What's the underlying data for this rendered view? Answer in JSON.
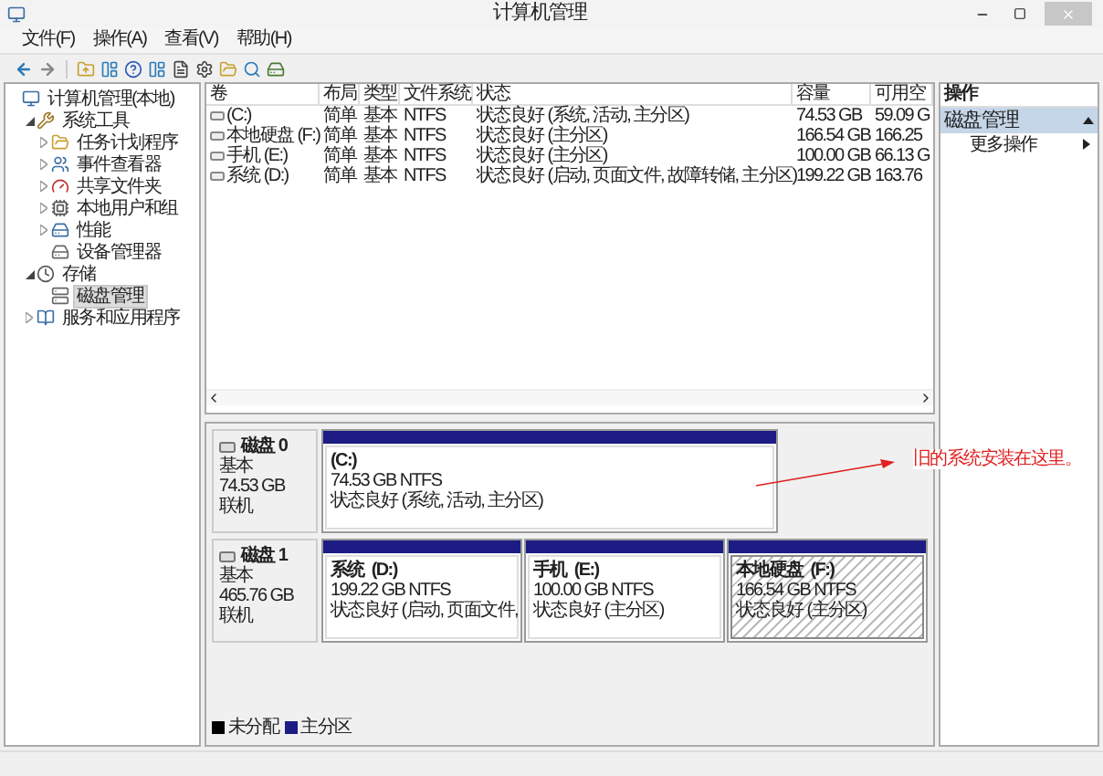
{
  "window": {
    "title": "计算机管理"
  },
  "menu": [
    "文件(F)",
    "操作(A)",
    "查看(V)",
    "帮助(H)"
  ],
  "tree": [
    {
      "label": "计算机管理(本地)",
      "selected": false,
      "children": [
        {
          "label": "系统工具",
          "expanded": true,
          "selected": false,
          "children": [
            {
              "label": "任务计划程序",
              "expanded": false,
              "selected": false
            },
            {
              "label": "事件查看器",
              "expanded": false,
              "selected": false
            },
            {
              "label": "共享文件夹",
              "expanded": false,
              "selected": false
            },
            {
              "label": "本地用户和组",
              "expanded": false,
              "selected": false
            },
            {
              "label": "性能",
              "expanded": false,
              "selected": false
            },
            {
              "label": "设备管理器",
              "selected": false
            }
          ]
        },
        {
          "label": "存储",
          "expanded": true,
          "selected": false,
          "children": [
            {
              "label": "磁盘管理",
              "selected": true
            }
          ]
        },
        {
          "label": "服务和应用程序",
          "expanded": false,
          "selected": false
        }
      ]
    }
  ],
  "table": {
    "columns": [
      "卷",
      "布局",
      "类型",
      "文件系统",
      "状态",
      "容量",
      "可用空"
    ],
    "rows": [
      [
        "(C:)",
        "简单",
        "基本",
        "NTFS",
        "状态良好 (系统, 活动, 主分区)",
        "74.53 GB",
        "59.09 G"
      ],
      [
        "本地硬盘 (F:)",
        "简单",
        "基本",
        "NTFS",
        "状态良好 (主分区)",
        "166.54 GB",
        "166.25"
      ],
      [
        "手机 (E:)",
        "简单",
        "基本",
        "NTFS",
        "状态良好 (主分区)",
        "100.00 GB",
        "66.13 G"
      ],
      [
        "系统 (D:)",
        "简单",
        "基本",
        "NTFS",
        "状态良好 (启动, 页面文件, 故障转储, 主分区)",
        "199.22 GB",
        "163.76"
      ]
    ]
  },
  "disks": [
    {
      "name": "磁盘 0",
      "type": "基本",
      "size": "74.53 GB",
      "status": "联机",
      "partitions": [
        {
          "kind": "primary",
          "name": "(C:)",
          "size": "74.53 GB NTFS",
          "status": "状态良好 (系统, 活动, 主分区)",
          "selected": false
        }
      ]
    },
    {
      "name": "磁盘 1",
      "type": "基本",
      "size": "465.76 GB",
      "status": "联机",
      "partitions": [
        {
          "kind": "primary",
          "name": "系统  (D:)",
          "size": "199.22 GB NTFS",
          "status": "状态良好 (启动, 页面文件,",
          "selected": false
        },
        {
          "kind": "primary",
          "name": "手机  (E:)",
          "size": "100.00 GB NTFS",
          "status": "状态良好 (主分区)",
          "selected": false
        },
        {
          "kind": "primary",
          "name": "本地硬盘  (F:)",
          "size": "166.54 GB NTFS",
          "status": "状态良好 (主分区)",
          "selected": true
        }
      ]
    }
  ],
  "legend": [
    {
      "label": "未分配",
      "color": "#000000"
    },
    {
      "label": "主分区",
      "color": "#1c1c84"
    }
  ],
  "annotation": {
    "text": "旧的系统安装在这里。"
  },
  "actions": {
    "header": "操作",
    "section": {
      "title": "磁盘管理",
      "expanded": true
    },
    "items": [
      "更多操作"
    ]
  }
}
